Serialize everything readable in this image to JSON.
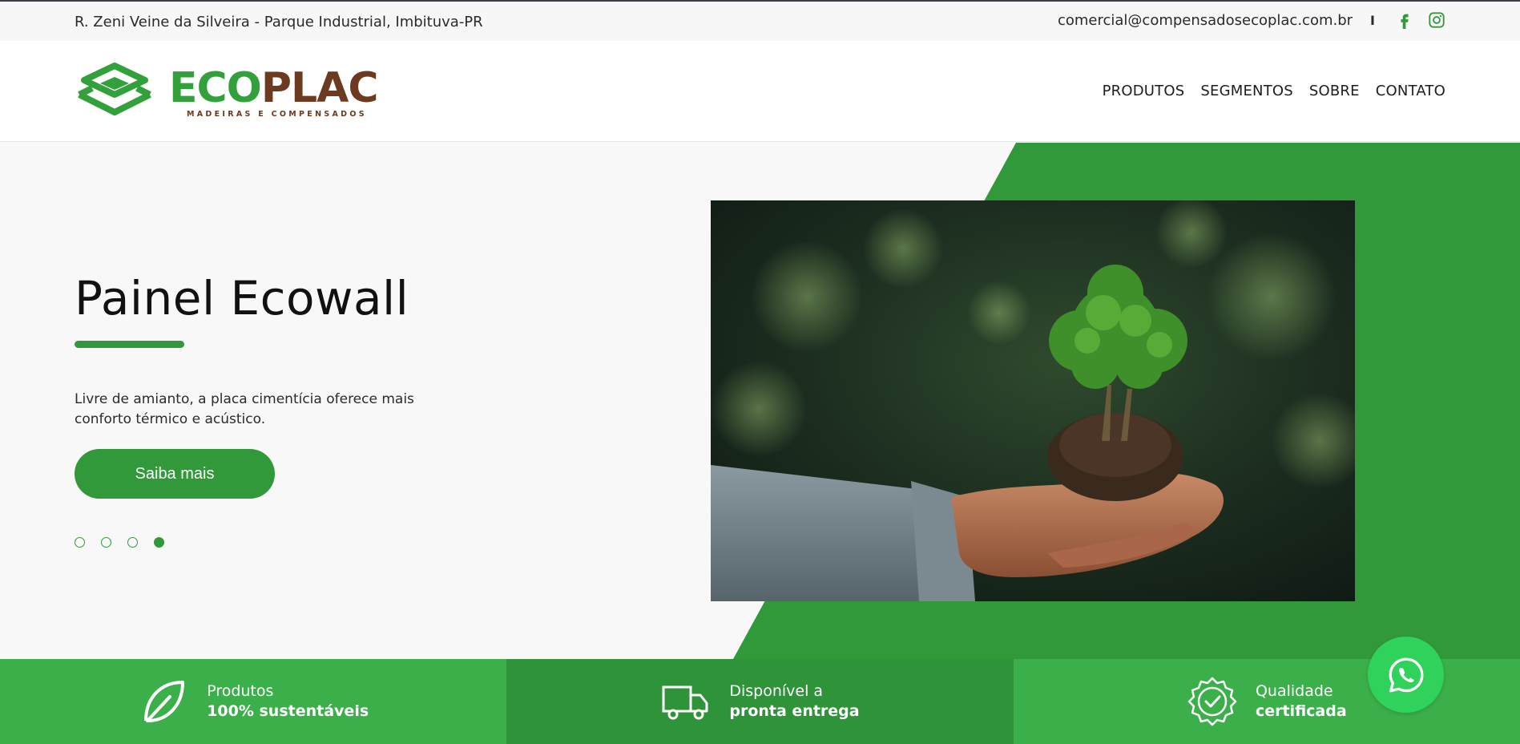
{
  "topbar": {
    "address": "R. Zeni Veine da Silveira - Parque Industrial, Imbituva-PR",
    "email": "comercial@compensadosecoplac.com.br",
    "separator": "I",
    "social": [
      "facebook-icon",
      "instagram-icon"
    ]
  },
  "logo": {
    "eco": "ECO",
    "plac": "PLAC",
    "tagline": "MADEIRAS E COMPENSADOS"
  },
  "nav": {
    "items": [
      "PRODUTOS",
      "SEGMENTOS",
      "SOBRE",
      "CONTATO"
    ]
  },
  "hero": {
    "title": "Painel Ecowall",
    "description": "Livre de amianto, a placa cimentícia oferece mais conforto térmico e acústico.",
    "button_label": "Saiba mais",
    "slides_total": 4,
    "active_slide": 4,
    "image": "hands-holding-small-tree-photo"
  },
  "features": [
    {
      "icon": "leaf-icon",
      "line1": "Produtos",
      "line2": "100% sustentáveis"
    },
    {
      "icon": "truck-icon",
      "line1": "Disponível a",
      "line2": "pronta entrega"
    },
    {
      "icon": "certified-badge-icon",
      "line1": "Qualidade",
      "line2": "certificada"
    }
  ],
  "colors": {
    "green": "#32993a",
    "green_light": "#3bb04a",
    "green_dark": "#2f9339",
    "brown": "#6b3a1f",
    "whatsapp": "#2fd25a"
  },
  "floating": {
    "icon": "whatsapp-icon"
  }
}
